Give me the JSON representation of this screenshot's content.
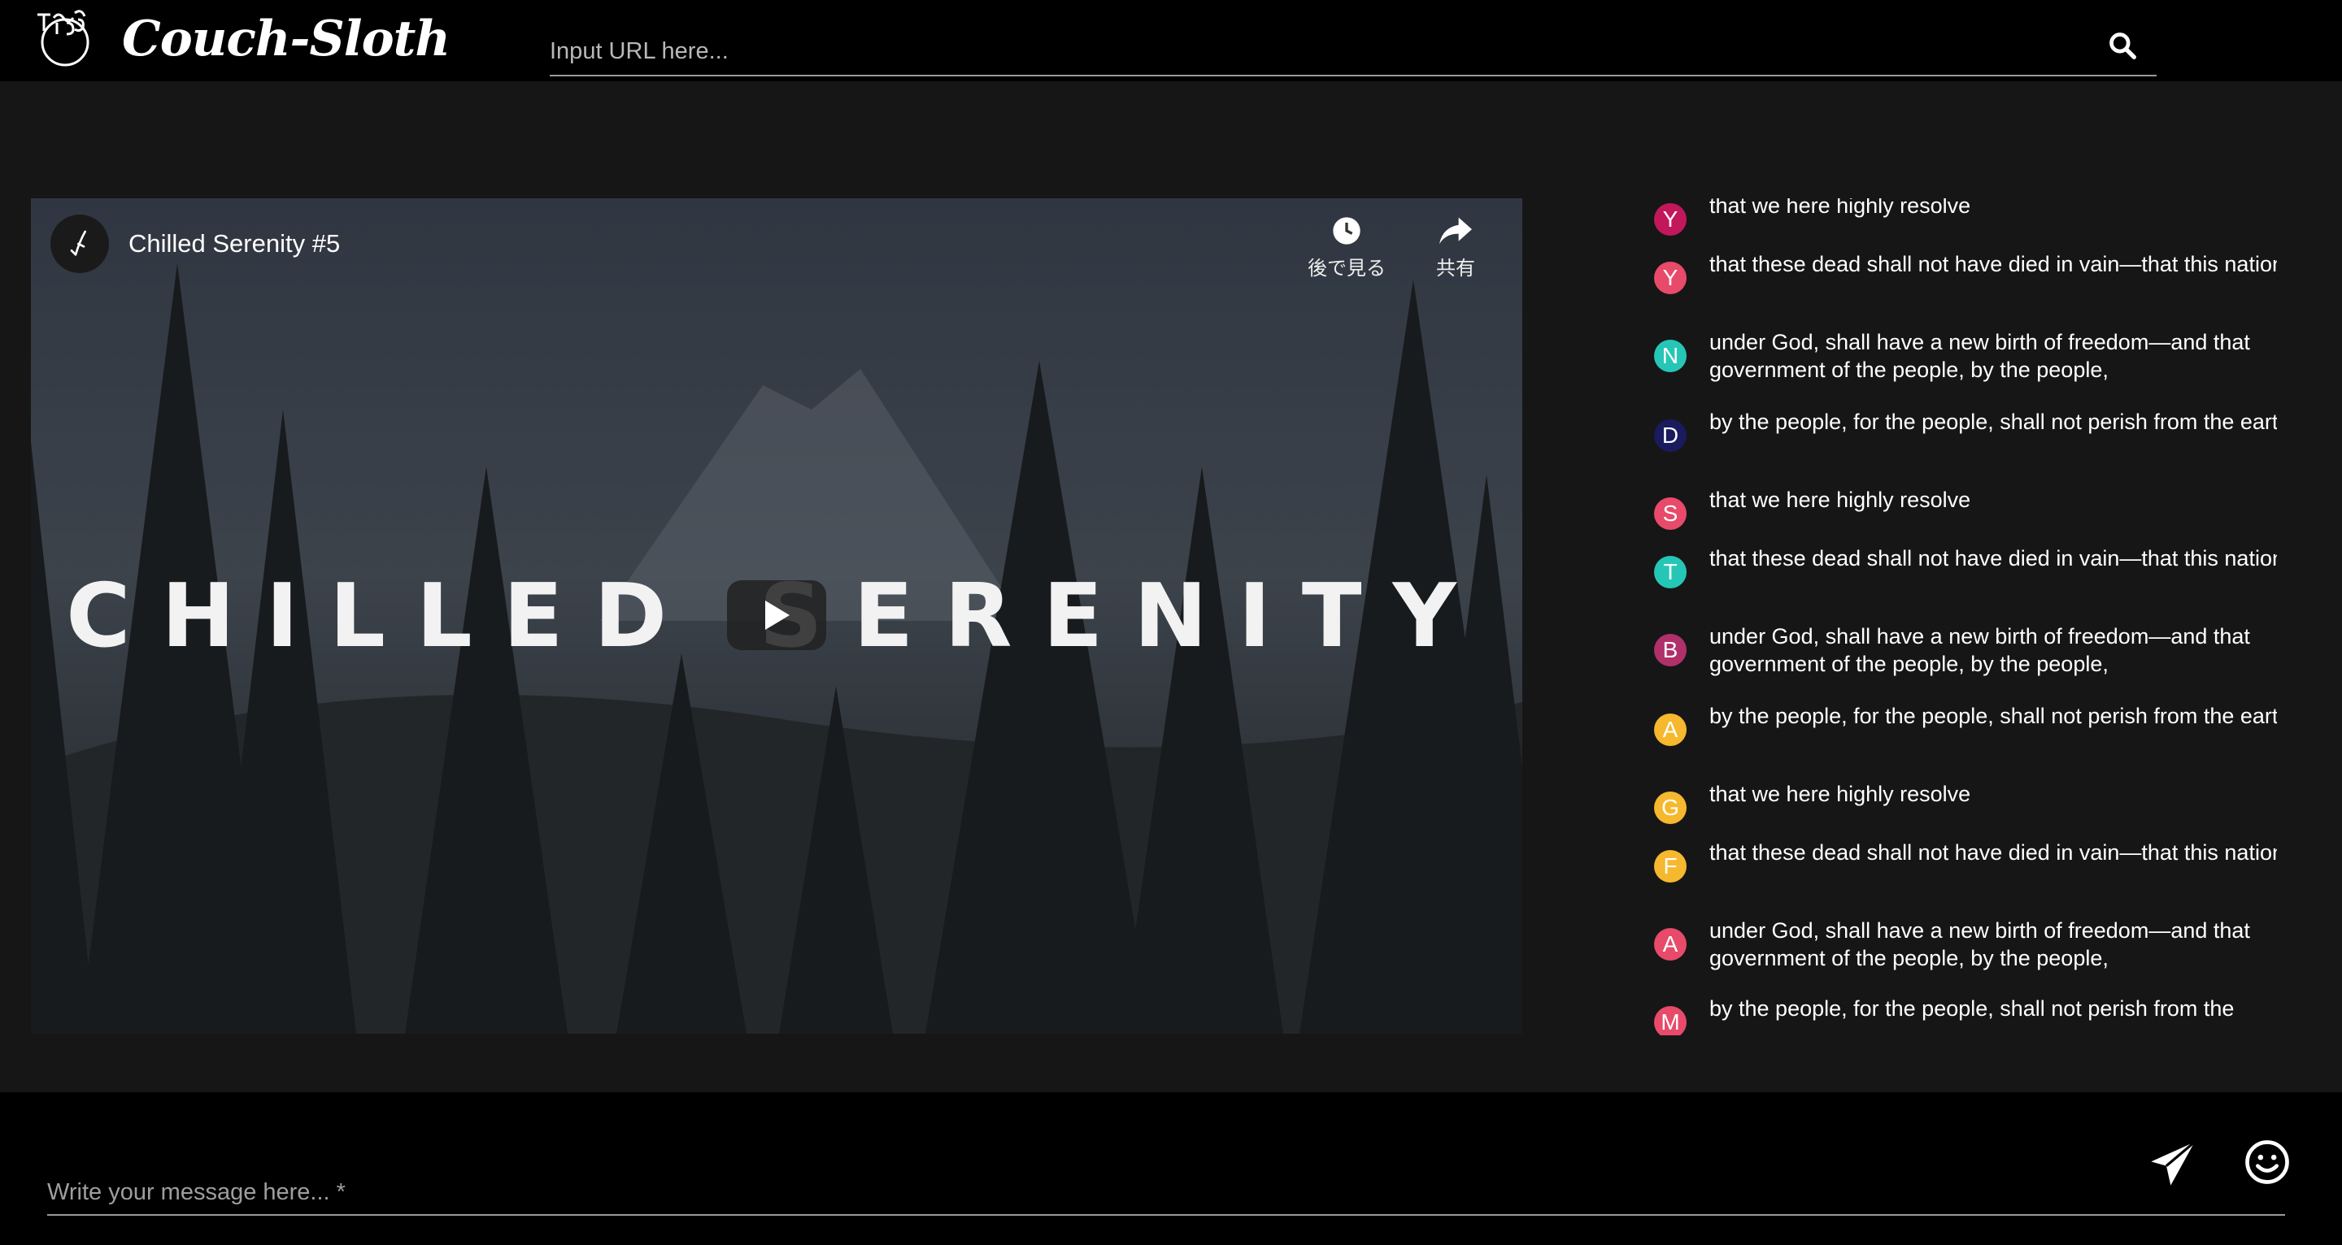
{
  "header": {
    "brand": "Couch-Sloth",
    "url_placeholder": "Input URL here...",
    "logo_icon": "sloth-logo-icon",
    "search_icon": "search-icon"
  },
  "video": {
    "channel_icon": "feather-icon",
    "title": "Chilled Serenity #5",
    "overlay_title": "CHILLED SERENITY",
    "watch_later_label": "後で見る",
    "share_label": "共有",
    "play_icon": "play-icon"
  },
  "chat": {
    "messages": [
      {
        "initial": "Y",
        "color": "#c2185b",
        "text": "that we here highly resolve"
      },
      {
        "initial": "Y",
        "color": "#e84a6a",
        "text": "that these dead shall not have died in vain—that this nation,"
      },
      {
        "initial": "N",
        "color": "#26c6b7",
        "text": "under God, shall have a new birth of freedom—and that government of the people, by the people,"
      },
      {
        "initial": "D",
        "color": "#1a1a5e",
        "text": "by the people, for the people, shall not perish from the earth."
      },
      {
        "initial": "S",
        "color": "#e84a6a",
        "text": "that we here highly resolve"
      },
      {
        "initial": "T",
        "color": "#26c6b7",
        "text": "that these dead shall not have died in vain—that this nation,"
      },
      {
        "initial": "B",
        "color": "#b0306a",
        "text": "under God, shall have a new birth of freedom—and that government of the people, by the people,"
      },
      {
        "initial": "A",
        "color": "#f5b82e",
        "text": "by the people, for the people, shall not perish from the earth."
      },
      {
        "initial": "G",
        "color": "#f5b82e",
        "text": "that we here highly resolve"
      },
      {
        "initial": "F",
        "color": "#f5b82e",
        "text": "that these dead shall not have died in vain—that this nation,"
      },
      {
        "initial": "A",
        "color": "#e84a6a",
        "text": "under God, shall have a new birth of freedom—and that government of the people, by the people,"
      },
      {
        "initial": "M",
        "color": "#e84a6a",
        "text": "by the people, for the people, shall not perish from the"
      }
    ]
  },
  "footer": {
    "message_placeholder": "Write your message here... *",
    "send_icon": "send-icon",
    "emoji_icon": "emoji-icon"
  }
}
